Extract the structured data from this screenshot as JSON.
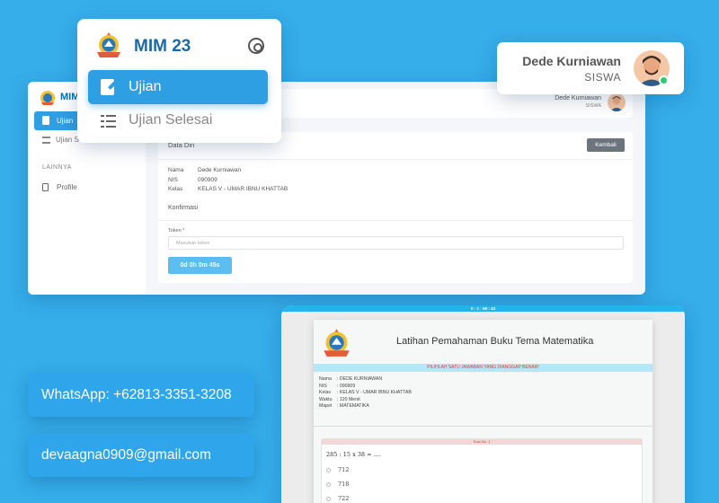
{
  "app": {
    "brand": "MIM 23"
  },
  "menu": {
    "items": [
      {
        "label": "Ujian",
        "active": true
      },
      {
        "label": "Ujian Selesai",
        "active": false
      }
    ]
  },
  "user": {
    "name": "Dede Kurniawan",
    "role": "SISWA",
    "status_color": "#2ecc71"
  },
  "dashboard": {
    "brand": "MIM",
    "nav_active": "Ujian",
    "nav_second": "Ujian S",
    "section": "LAINNYA",
    "nav_profile": "Profile",
    "user_name": "Dede Kurniawan",
    "user_role": "SISWA",
    "card_title": "Data Diri",
    "back_label": "Kembali",
    "info": {
      "nama_label": "Nama",
      "nama": "Dede Kurniawan",
      "nis_label": "NIS",
      "nis": "090909",
      "kelas_label": "Kelas",
      "kelas": "KELAS V - UMAR IBNU KHATTAB"
    },
    "confirm_title": "Konfirmasi",
    "token_label": "Token *",
    "token_placeholder": "Masukan token",
    "timer": "0d 0h 0m 45s"
  },
  "contact": {
    "whatsapp": "WhatsApp: +62813-3351-3208",
    "email": "devaagna0909@gmail.com"
  },
  "exam": {
    "status_time": "0 : 1 : 59 : 43",
    "title": "Latihan Pemahaman Buku Tema Matematika",
    "instruction": "PILIHLAH SATU JAWABAN YANG DIANGGAP BENAR!",
    "meta": [
      {
        "k": "Nama",
        "v": "DEDE KURNIAWAN"
      },
      {
        "k": "NIS",
        "v": "090909"
      },
      {
        "k": "Kelas",
        "v": "KELAS V - UMAR IBNU KHATTAB"
      },
      {
        "k": "Waktu",
        "v": "120 Menit"
      },
      {
        "k": "Mapel",
        "v": "MATEMATIKA"
      }
    ],
    "question_header": "Soal No. 1",
    "question": "285 : 15 x 38 = ....",
    "options": [
      "712",
      "718",
      "722"
    ]
  },
  "colors": {
    "primary": "#2f9fe3",
    "background": "#35aeea",
    "brand_text": "#1a6aa7"
  }
}
